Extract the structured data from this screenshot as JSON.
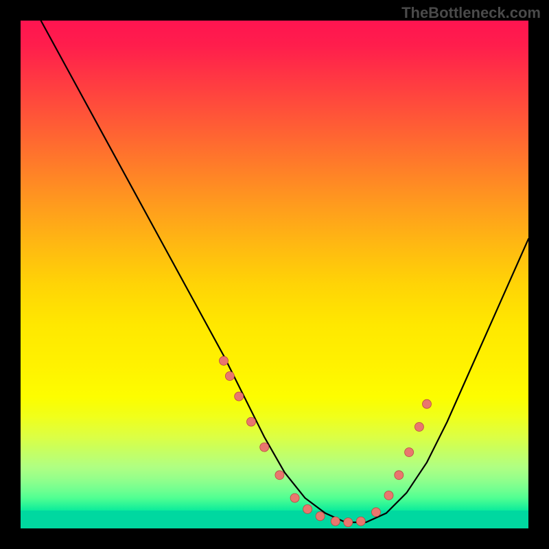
{
  "watermark": "TheBottleneck.com",
  "chart_data": {
    "type": "line",
    "title": "",
    "xlabel": "",
    "ylabel": "",
    "xlim": [
      0,
      100
    ],
    "ylim": [
      0,
      100
    ],
    "curve": {
      "x": [
        4,
        10,
        16,
        22,
        28,
        34,
        40,
        44,
        48,
        52,
        56,
        60,
        64,
        68,
        72,
        76,
        80,
        84,
        88,
        92,
        96,
        100
      ],
      "y": [
        100,
        89,
        78,
        67,
        56,
        45,
        34,
        26,
        18,
        11,
        6,
        3,
        1.2,
        1.2,
        3,
        7,
        13,
        21,
        30,
        39,
        48,
        57
      ]
    },
    "dots": {
      "x": [
        40.0,
        41.2,
        43.0,
        45.4,
        48.0,
        51.0,
        54.0,
        56.5,
        59.0,
        62.0,
        64.5,
        67.0,
        70.0,
        72.5,
        74.5,
        76.5,
        78.5,
        80.0
      ],
      "y": [
        33.0,
        30.0,
        26.0,
        21.0,
        16.0,
        10.5,
        6.0,
        3.8,
        2.4,
        1.4,
        1.2,
        1.4,
        3.2,
        6.5,
        10.5,
        15.0,
        20.0,
        24.5
      ]
    },
    "background_gradient": {
      "top": "#ff1450",
      "mid": "#ffe800",
      "bottom": "#00d8a0"
    }
  }
}
